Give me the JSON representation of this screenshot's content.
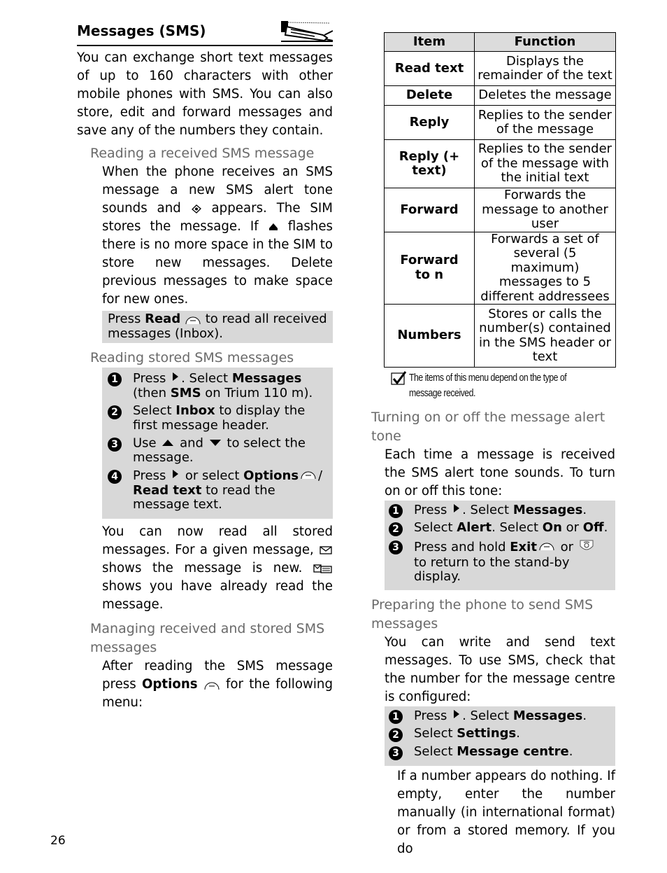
{
  "page": {
    "title": "Messages (SMS)",
    "page_number": "26",
    "title_image": "message-in-a-bottle-illustration"
  },
  "left": {
    "intro": "You can exchange short text messages of up to 160 characters with other mobile phones with SMS. You can also store, edit and forward messages and save any of the numbers they contain.",
    "section1": {
      "heading": "Reading a received SMS message",
      "body_parts": [
        "When the phone receives an SMS message a new SMS alert tone sounds and ",
        " appears. The SIM stores the message. If ",
        " flashes there is no more space in the SIM to store new messages. Delete previous messages to make space for new ones."
      ],
      "icons": [
        "sms-received-icon",
        "sms-full-icon"
      ],
      "tip": {
        "pre": "Press ",
        "bold": "Read",
        "post": " to read all received messages (Inbox).",
        "icon": "softkey-icon"
      }
    },
    "section2": {
      "heading": "Reading stored SMS messages",
      "steps": [
        {
          "num": "1",
          "parts": [
            {
              "t": "Press "
            },
            {
              "icon": "right-arrow-icon"
            },
            {
              "t": ". Select "
            },
            {
              "b": "Messages"
            },
            {
              "t": " (then "
            },
            {
              "b": "SMS"
            },
            {
              "t": " on Trium 110 m)."
            }
          ]
        },
        {
          "num": "2",
          "parts": [
            {
              "t": "Select "
            },
            {
              "b": "Inbox"
            },
            {
              "t": " to display the first message header."
            }
          ]
        },
        {
          "num": "3",
          "parts": [
            {
              "t": "Use "
            },
            {
              "icon": "up-arrow-icon"
            },
            {
              "t": " and "
            },
            {
              "icon": "down-arrow-icon"
            },
            {
              "t": " to select the message."
            }
          ]
        },
        {
          "num": "4",
          "parts": [
            {
              "t": "Press "
            },
            {
              "icon": "right-arrow-icon"
            },
            {
              "t": " or select "
            },
            {
              "b": "Options"
            },
            {
              "icon": "softkey-icon"
            },
            {
              "t": "/ "
            },
            {
              "b": "Read text"
            },
            {
              "t": " to read the message text."
            }
          ]
        }
      ],
      "after_parts": [
        "You can now read all stored messages. For a given message, ",
        " shows the message is new. ",
        " shows you have already read the message."
      ],
      "after_icons": [
        "new-message-envelope-icon",
        "read-message-icon"
      ]
    },
    "section3": {
      "heading": "Managing received and stored SMS messages",
      "body_pre": "After reading the SMS message press ",
      "body_bold": "Options",
      "body_post": " for the following menu:"
    }
  },
  "right": {
    "table": {
      "headers": [
        "Item",
        "Function"
      ],
      "rows": [
        {
          "item": "Read text",
          "function": "Displays the remainder of the text"
        },
        {
          "item": "Delete",
          "function": "Deletes the message"
        },
        {
          "item": "Reply",
          "function": "Replies to the sender of the message"
        },
        {
          "item": "Reply (+ text)",
          "function": "Replies to the sender of the message with the initial text"
        },
        {
          "item": "Forward",
          "function": "Forwards the message to another user"
        },
        {
          "item": "Forward to n",
          "function": "Forwards a set of several (5 maximum) messages to 5 different addressees"
        },
        {
          "item": "Numbers",
          "function": "Stores or calls the number(s) contained in the SMS header or text"
        }
      ]
    },
    "note": "The items of this menu depend on the type of message received.",
    "section4": {
      "heading": "Turning on or off the message alert tone",
      "body": "Each time a message is received the SMS alert tone sounds. To turn on or off this tone:",
      "steps": [
        {
          "num": "1",
          "parts": [
            {
              "t": "Press "
            },
            {
              "icon": "right-arrow-icon"
            },
            {
              "t": ". Select "
            },
            {
              "b": "Messages"
            },
            {
              "t": "."
            }
          ]
        },
        {
          "num": "2",
          "parts": [
            {
              "t": "Select "
            },
            {
              "b": "Alert"
            },
            {
              "t": ". Select "
            },
            {
              "b": "On"
            },
            {
              "t": " or "
            },
            {
              "b": "Off"
            },
            {
              "t": "."
            }
          ]
        },
        {
          "num": "3",
          "parts": [
            {
              "t": "Press and hold "
            },
            {
              "b": "Exit"
            },
            {
              "icon": "softkey-icon"
            },
            {
              "t": " or "
            },
            {
              "icon": "end-call-key-icon"
            },
            {
              "t": " to return to the stand-by display."
            }
          ]
        }
      ]
    },
    "section5": {
      "heading": "Preparing the phone to send SMS messages",
      "body": "You can write and send text messages. To use SMS, check that the number for the message centre is configured:",
      "steps": [
        {
          "num": "1",
          "parts": [
            {
              "t": "Press "
            },
            {
              "icon": "right-arrow-icon"
            },
            {
              "t": ". Select "
            },
            {
              "b": "Messages"
            },
            {
              "t": "."
            }
          ]
        },
        {
          "num": "2",
          "parts": [
            {
              "t": "Select "
            },
            {
              "b": "Settings"
            },
            {
              "t": "."
            }
          ]
        },
        {
          "num": "3",
          "parts": [
            {
              "t": "Select "
            },
            {
              "b": "Message centre"
            },
            {
              "t": "."
            }
          ]
        }
      ],
      "after": "If a number appears do nothing. If empty, enter the number manually (in international format) or from a stored memory. If you do"
    }
  }
}
